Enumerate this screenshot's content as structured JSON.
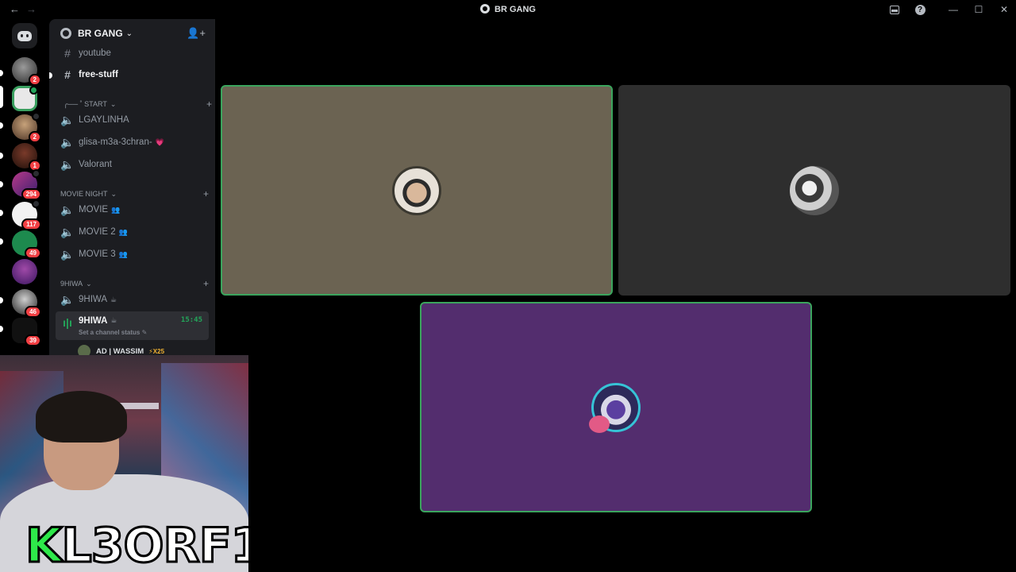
{
  "window": {
    "title": "BR GANG",
    "nav_back": "←",
    "nav_forward": "→",
    "minimize": "—",
    "maximize": "☐",
    "close": "✕",
    "help": "?"
  },
  "server_rail": {
    "badges": [
      "2",
      "2",
      "1",
      "294",
      "117",
      "49",
      "46",
      "39"
    ]
  },
  "server": {
    "name": "BR GANG",
    "chevron": "⌄",
    "invite_icon": "person-add-icon"
  },
  "channels": {
    "text": [
      {
        "name": "youtube"
      },
      {
        "name": "free-stuff"
      }
    ],
    "categories": [
      {
        "label": "╭── ˚ start",
        "plus": "+"
      },
      {
        "label": "MOVIE NIGHT",
        "plus": "+"
      },
      {
        "label": "9HIWA",
        "plus": "+"
      }
    ],
    "voice": [
      {
        "name": "LGAYLINHA"
      },
      {
        "name": "glisa-m3a-3chran-",
        "emoji": "💗"
      },
      {
        "name": "Valorant"
      },
      {
        "name": "MOVIE",
        "emoji": "👥"
      },
      {
        "name": "MOVIE 2",
        "emoji": "👥"
      },
      {
        "name": "MOVIE 3",
        "emoji": "👥"
      },
      {
        "name": "9HIWA",
        "emoji": "☕"
      }
    ],
    "active_voice": {
      "name": "9HIWA",
      "emoji": "☕",
      "time": "15:45",
      "status": "Set a channel status ✎"
    },
    "voice_user": {
      "name": "AD | WASSIM",
      "boost": "⚡X25"
    }
  },
  "webcam": {
    "tag_first": "K",
    "tag_rest": "L3ORF1"
  },
  "colors": {
    "speaking_border": "#3ba55d",
    "tile1_bg": "#6b6352",
    "tile2_bg": "#2e2e2e",
    "tile3_bg": "#532d6e",
    "tag_green": "#2ee84a"
  }
}
